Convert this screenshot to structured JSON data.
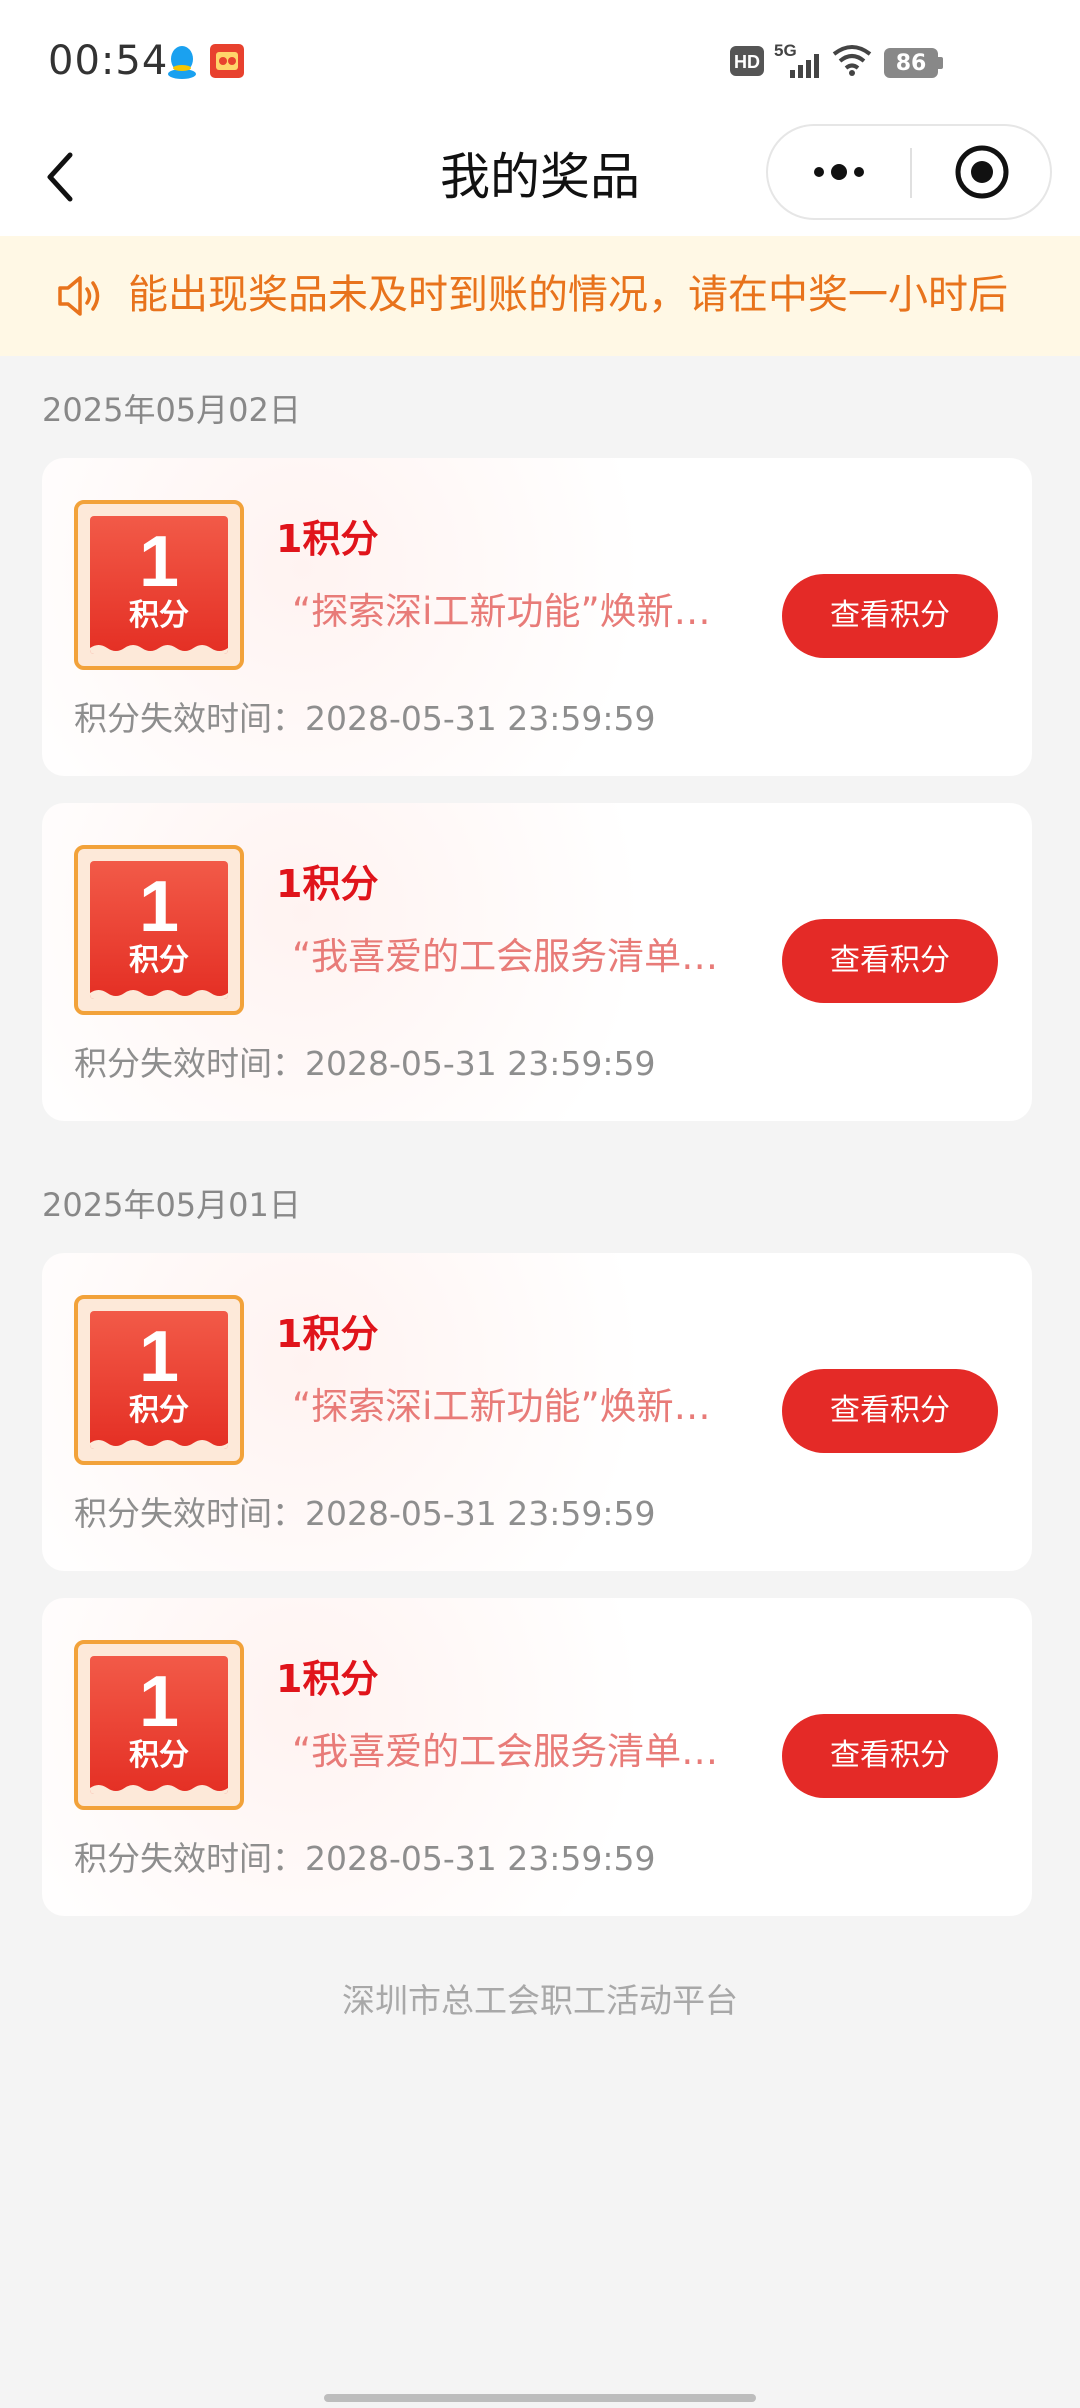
{
  "status_bar": {
    "time": "00:54",
    "signal_label": "5G",
    "hd_label": "HD",
    "battery": "86"
  },
  "nav": {
    "title": "我的奖品"
  },
  "notice": {
    "text": "能出现奖品未及时到账的情况，请在中奖一小时后"
  },
  "groups": [
    {
      "date": "2025年05月02日",
      "items": [
        {
          "badge_num": "1",
          "badge_unit": "积分",
          "name": "1积分",
          "desc": "“探索深i工新功能”焕新…",
          "button": "查看积分",
          "expire": "积分失效时间：2028-05-31 23:59:59"
        },
        {
          "badge_num": "1",
          "badge_unit": "积分",
          "name": "1积分",
          "desc": "“我喜爱的工会服务清单…",
          "button": "查看积分",
          "expire": "积分失效时间：2028-05-31 23:59:59"
        }
      ]
    },
    {
      "date": "2025年05月01日",
      "items": [
        {
          "badge_num": "1",
          "badge_unit": "积分",
          "name": "1积分",
          "desc": "“探索深i工新功能”焕新…",
          "button": "查看积分",
          "expire": "积分失效时间：2028-05-31 23:59:59"
        },
        {
          "badge_num": "1",
          "badge_unit": "积分",
          "name": "1积分",
          "desc": "“我喜爱的工会服务清单…",
          "button": "查看积分",
          "expire": "积分失效时间：2028-05-31 23:59:59"
        }
      ]
    }
  ],
  "footer": "深圳市总工会职工活动平台",
  "colors": {
    "accent_red": "#e42a27",
    "notice_orange": "#e8731c",
    "badge_border": "#f2a23a"
  }
}
